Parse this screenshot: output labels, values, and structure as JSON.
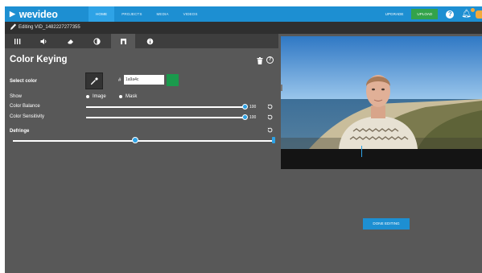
{
  "brand": {
    "logo": "wevideo",
    "accent": "#1d8fd2",
    "active_tab_bg": "#2ea3e6",
    "upload_green": "#33a34a"
  },
  "nav": {
    "items": [
      {
        "label": "HOME",
        "active": true
      },
      {
        "label": "PROJECTS",
        "active": false
      },
      {
        "label": "MEDIA",
        "active": false
      },
      {
        "label": "VIDEOS",
        "active": false
      }
    ],
    "upgrade": "UPGRADE",
    "upload": "UPLOAD",
    "help": "?"
  },
  "editbar": {
    "title": "Editing VID_1482227277355"
  },
  "tooltabs": [
    {
      "icon": "sliders-icon",
      "active": false
    },
    {
      "icon": "volume-icon",
      "active": false
    },
    {
      "icon": "eraser-icon",
      "active": false
    },
    {
      "icon": "contrast-icon",
      "active": false
    },
    {
      "icon": "color-key-icon",
      "active": true
    },
    {
      "icon": "info-icon",
      "active": false
    }
  ],
  "panel": {
    "title": "Color Keying",
    "select_color": {
      "label": "Select color",
      "hash": "#",
      "hex": "1a9a4c",
      "swatch_color": "#1a9a4c"
    },
    "show": {
      "label": "Show",
      "options": [
        "Image",
        "Mask"
      ],
      "selected": "Image"
    },
    "color_balance": {
      "label": "Color Balance",
      "value": "100",
      "level": 1.0
    },
    "color_sensitivity": {
      "label": "Color Sensitivity",
      "value": "100",
      "level": 1.0
    },
    "defringe": {
      "label": "Defringe",
      "level": 0.47
    }
  },
  "done_button": "DONE EDITING"
}
